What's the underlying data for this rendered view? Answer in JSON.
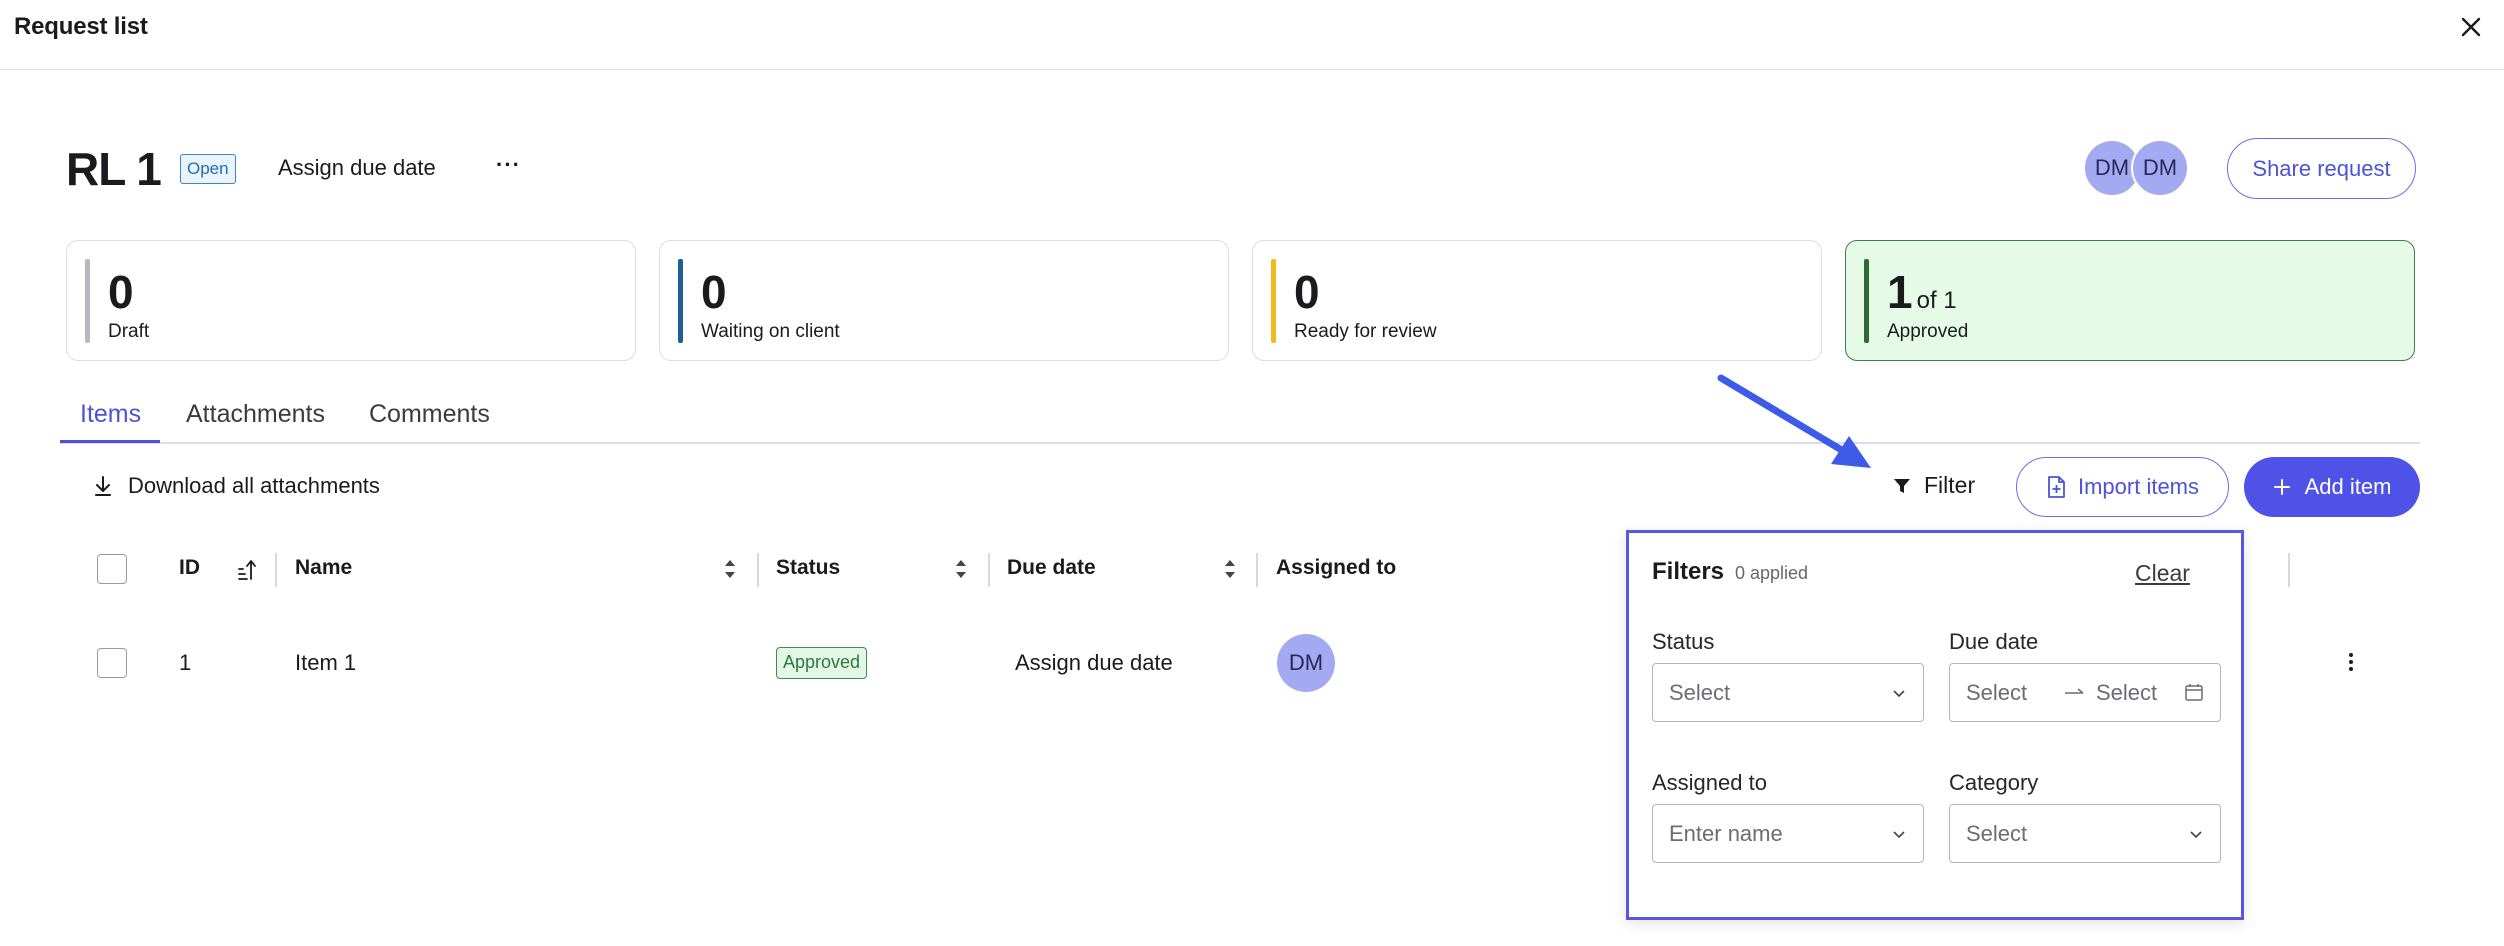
{
  "window": {
    "title": "Request list",
    "close_icon": "close-icon"
  },
  "header": {
    "title": "RL 1",
    "status_badge": "Open",
    "assign_due_date": "Assign due date",
    "more": "···",
    "avatars": [
      "DM",
      "DM"
    ],
    "share_button": "Share request"
  },
  "stats": [
    {
      "count": "0",
      "label": "Draft",
      "color": "#b8b8be"
    },
    {
      "count": "0",
      "label": "Waiting on client",
      "color": "#1d5f99"
    },
    {
      "count": "0",
      "label": "Ready for review",
      "color": "#f2b91c"
    },
    {
      "count": "1",
      "of": "of 1",
      "label": "Approved",
      "color": "#2e6b36"
    }
  ],
  "tabs": [
    {
      "label": "Items",
      "active": true
    },
    {
      "label": "Attachments",
      "active": false
    },
    {
      "label": "Comments",
      "active": false
    }
  ],
  "toolbar": {
    "download_all": "Download all attachments",
    "filter": "Filter",
    "import_items": "Import items",
    "add_item": "Add item"
  },
  "table": {
    "columns": [
      "ID",
      "Name",
      "Status",
      "Due date",
      "Assigned to"
    ],
    "rows": [
      {
        "id": "1",
        "name": "Item 1",
        "status": "Approved",
        "due_date": "Assign due date",
        "assigned_to": "DM"
      }
    ]
  },
  "filters": {
    "title": "Filters",
    "applied": "0 applied",
    "clear": "Clear",
    "status_label": "Status",
    "status_placeholder": "Select",
    "due_date_label": "Due date",
    "due_date_from": "Select",
    "due_date_to": "Select",
    "assigned_to_label": "Assigned to",
    "assigned_to_placeholder": "Enter name",
    "category_label": "Category",
    "category_placeholder": "Select"
  },
  "colors": {
    "accent": "#4e52e6",
    "approved_bg": "#e6fae8",
    "annotation_arrow": "#3d5ae8"
  }
}
